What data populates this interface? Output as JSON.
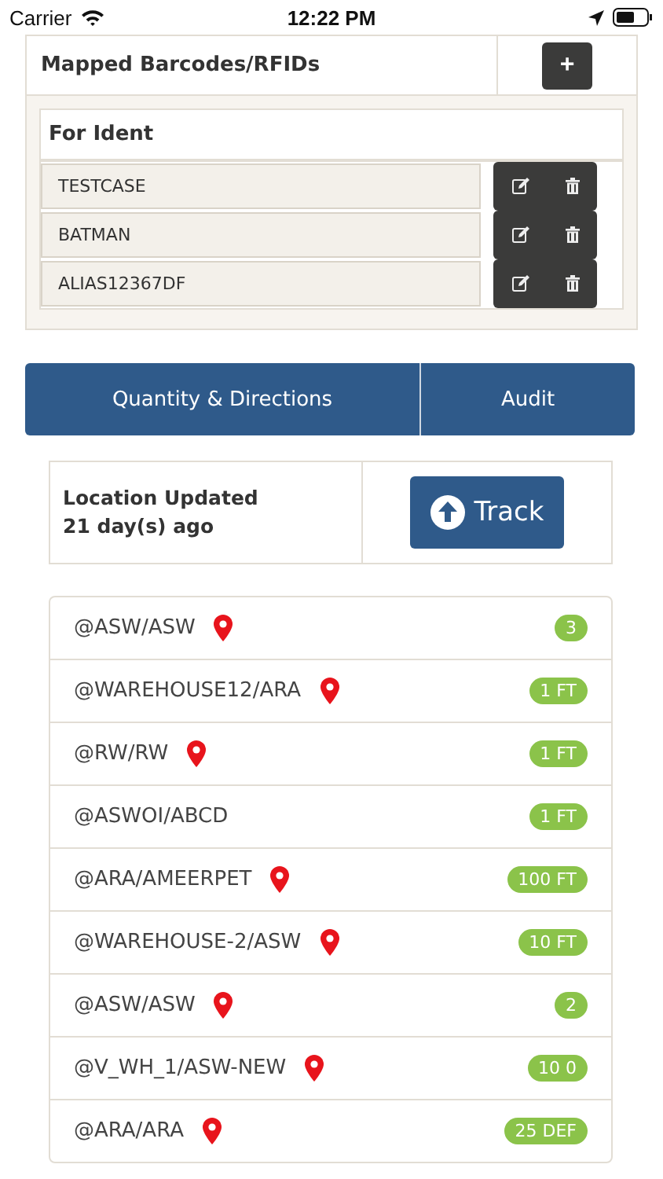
{
  "status_bar": {
    "carrier": "Carrier",
    "time": "12:22 PM"
  },
  "mapped": {
    "title": "Mapped Barcodes/RFIDs",
    "add_label": "+",
    "section": "For Ident",
    "items": [
      "TESTCASE",
      "BATMAN",
      "ALIAS12367DF"
    ]
  },
  "tabs": [
    "Quantity & Directions",
    "Audit"
  ],
  "location": {
    "line1": "Location Updated",
    "line2": "21 day(s) ago",
    "track_label": "Track"
  },
  "locations": [
    {
      "name": "@ASW/ASW",
      "pin": true,
      "badge": "3"
    },
    {
      "name": "@WAREHOUSE12/ARA",
      "pin": true,
      "badge": "1 FT"
    },
    {
      "name": "@RW/RW",
      "pin": true,
      "badge": "1 FT"
    },
    {
      "name": "@ASWOI/ABCD",
      "pin": false,
      "badge": "1 FT"
    },
    {
      "name": "@ARA/AMEERPET",
      "pin": true,
      "badge": "100 FT"
    },
    {
      "name": "@WAREHOUSE-2/ASW",
      "pin": true,
      "badge": "10 FT"
    },
    {
      "name": "@ASW/ASW",
      "pin": true,
      "badge": "2"
    },
    {
      "name": "@V_WH_1/ASW-NEW",
      "pin": true,
      "badge": "10 0"
    },
    {
      "name": "@ARA/ARA",
      "pin": true,
      "badge": "25 DEF"
    }
  ]
}
